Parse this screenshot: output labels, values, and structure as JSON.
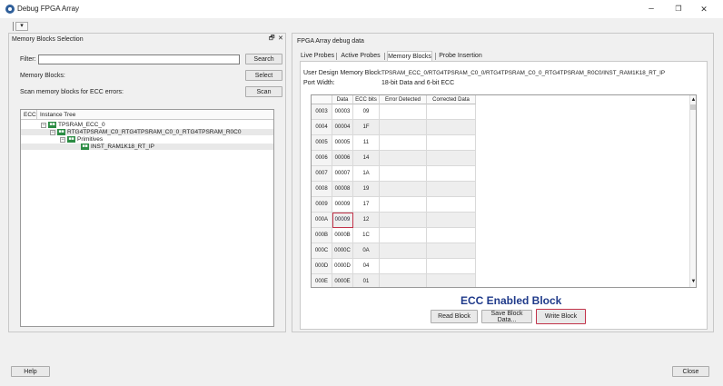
{
  "window": {
    "title": "Debug FPGA Array",
    "minimize": "–",
    "maximize": "❐",
    "close": "✕"
  },
  "toolbar": {
    "menu_glyph": "▾"
  },
  "left": {
    "title": "Memory Blocks Selection",
    "float_glyph": "🗗",
    "close_glyph": "✕",
    "filter_label": "Filter:",
    "filter_value": "",
    "search_label": "Search",
    "memory_blocks_label": "Memory Blocks:",
    "select_label": "Select",
    "scan_text": "Scan memory blocks for ECC errors:",
    "scan_label": "Scan",
    "tree": {
      "col_ecc": "ECC",
      "col_instance": "Instance Tree",
      "expander": "−",
      "nodes": [
        "TPSRAM_ECC_0",
        "RTG4TPSRAM_C0_RTG4TPSRAM_C0_0_RTG4TPSRAM_R0C0",
        "Primitives",
        "INST_RAM1K18_RT_IP"
      ]
    }
  },
  "right": {
    "title": "FPGA Array debug data",
    "tabs": [
      "Live Probes",
      "Active Probes",
      "Memory Blocks",
      "Probe Insertion"
    ],
    "user_design_label": "User Design Memory Block:",
    "user_design_value": "TPSRAM_ECC_0/RTG4TPSRAM_C0_0/RTG4TPSRAM_C0_0_RTG4TPSRAM_R0C0/INST_RAM1K18_RT_IP",
    "port_width_label": "Port Width:",
    "port_width_value": "18-bit Data and 6-bit ECC",
    "grid": {
      "headers": [
        "",
        "Data",
        "ECC bits",
        "Error Detected",
        "Corrected Data"
      ],
      "rows": [
        [
          "0003",
          "00003",
          "09"
        ],
        [
          "0004",
          "00004",
          "1F"
        ],
        [
          "0005",
          "00005",
          "11"
        ],
        [
          "0006",
          "00006",
          "14"
        ],
        [
          "0007",
          "00007",
          "1A"
        ],
        [
          "0008",
          "00008",
          "19"
        ],
        [
          "0009",
          "00009",
          "17"
        ],
        [
          "000A",
          "00009",
          "12"
        ],
        [
          "000B",
          "0000B",
          "1C"
        ],
        [
          "000C",
          "0000C",
          "0A"
        ],
        [
          "000D",
          "0000D",
          "04"
        ],
        [
          "000E",
          "0000E",
          "01"
        ]
      ],
      "scroll_up": "▲",
      "scroll_down": "▼"
    },
    "ecc_title": "ECC Enabled Block",
    "read_label": "Read Block",
    "save_label": "Save Block Data...",
    "write_label": "Write Block"
  },
  "footer": {
    "help_label": "Help",
    "close_label": "Close"
  }
}
